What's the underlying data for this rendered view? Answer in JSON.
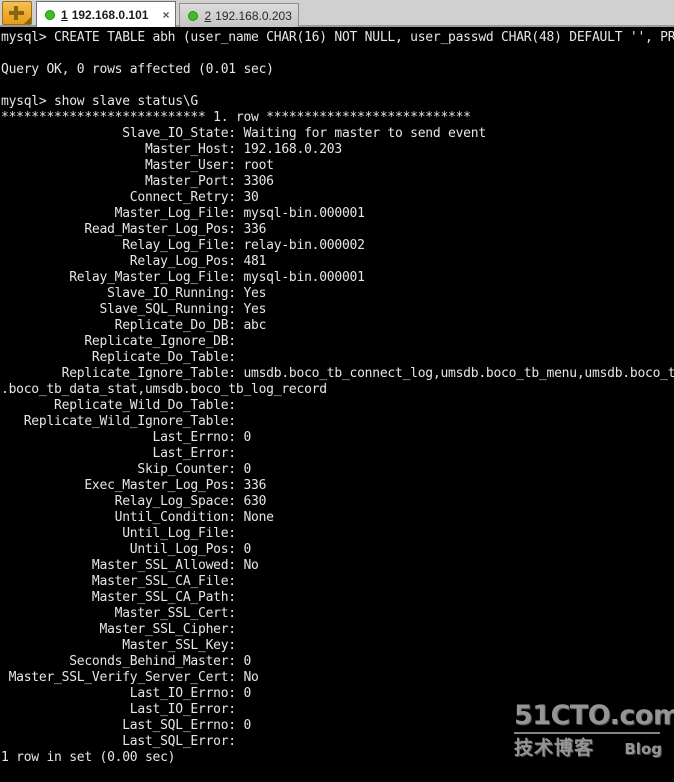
{
  "window": {
    "tabbar": {
      "new_tab_button": {
        "name": "new-tab-button",
        "icon": "plus-icon",
        "color": "#e39b17"
      },
      "tabs": [
        {
          "index": "1",
          "label": "192.168.0.101",
          "active": true,
          "status_dot_color": "#3fbf20",
          "close_label": "×"
        },
        {
          "index": "2",
          "label": "192.168.0.203",
          "active": false,
          "status_dot_color": "#3fbf20",
          "close_label": ""
        }
      ]
    }
  },
  "terminal": {
    "background": "#000000",
    "foreground": "#e6e6e6",
    "lines": [
      "mysql> CREATE TABLE abh (user_name CHAR(16) NOT NULL, user_passwd CHAR(48) DEFAULT '', PRIMARY K",
      "",
      "Query OK, 0 rows affected (0.01 sec)",
      "",
      "mysql> show slave status\\G",
      "*************************** 1. row ***************************",
      "                Slave_IO_State: Waiting for master to send event",
      "                   Master_Host: 192.168.0.203",
      "                   Master_User: root",
      "                   Master_Port: 3306",
      "                 Connect_Retry: 30",
      "               Master_Log_File: mysql-bin.000001",
      "           Read_Master_Log_Pos: 336",
      "                Relay_Log_File: relay-bin.000002",
      "                 Relay_Log_Pos: 481",
      "         Relay_Master_Log_File: mysql-bin.000001",
      "              Slave_IO_Running: Yes",
      "             Slave_SQL_Running: Yes",
      "               Replicate_Do_DB: abc",
      "           Replicate_Ignore_DB:",
      "            Replicate_Do_Table:",
      "        Replicate_Ignore_Table: umsdb.boco_tb_connect_log,umsdb.boco_tb_menu,umsdb.boco_tb_workor",
      ".boco_tb_data_stat,umsdb.boco_tb_log_record",
      "       Replicate_Wild_Do_Table:",
      "   Replicate_Wild_Ignore_Table:",
      "                    Last_Errno: 0",
      "                    Last_Error:",
      "                  Skip_Counter: 0",
      "           Exec_Master_Log_Pos: 336",
      "               Relay_Log_Space: 630",
      "               Until_Condition: None",
      "                Until_Log_File:",
      "                 Until_Log_Pos: 0",
      "            Master_SSL_Allowed: No",
      "            Master_SSL_CA_File:",
      "            Master_SSL_CA_Path:",
      "               Master_SSL_Cert:",
      "             Master_SSL_Cipher:",
      "                Master_SSL_Key:",
      "         Seconds_Behind_Master: 0",
      " Master_SSL_Verify_Server_Cert: No",
      "                 Last_IO_Errno: 0",
      "                 Last_IO_Error:",
      "                Last_SQL_Errno: 0",
      "                Last_SQL_Error:",
      "1 row in set (0.00 sec)"
    ]
  },
  "watermark": {
    "main": "51CTO.com",
    "chinese": "技术博客",
    "blog": "Blog"
  }
}
